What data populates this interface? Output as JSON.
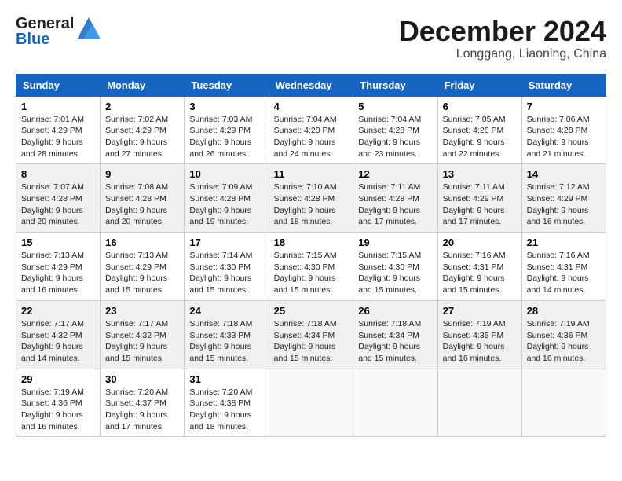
{
  "header": {
    "logo": {
      "general": "General",
      "blue": "Blue"
    },
    "title": "December 2024",
    "location": "Longgang, Liaoning, China"
  },
  "calendar": {
    "headers": [
      "Sunday",
      "Monday",
      "Tuesday",
      "Wednesday",
      "Thursday",
      "Friday",
      "Saturday"
    ],
    "rows": [
      [
        {
          "day": "1",
          "sunrise": "Sunrise: 7:01 AM",
          "sunset": "Sunset: 4:29 PM",
          "daylight": "Daylight: 9 hours and 28 minutes."
        },
        {
          "day": "2",
          "sunrise": "Sunrise: 7:02 AM",
          "sunset": "Sunset: 4:29 PM",
          "daylight": "Daylight: 9 hours and 27 minutes."
        },
        {
          "day": "3",
          "sunrise": "Sunrise: 7:03 AM",
          "sunset": "Sunset: 4:29 PM",
          "daylight": "Daylight: 9 hours and 26 minutes."
        },
        {
          "day": "4",
          "sunrise": "Sunrise: 7:04 AM",
          "sunset": "Sunset: 4:28 PM",
          "daylight": "Daylight: 9 hours and 24 minutes."
        },
        {
          "day": "5",
          "sunrise": "Sunrise: 7:04 AM",
          "sunset": "Sunset: 4:28 PM",
          "daylight": "Daylight: 9 hours and 23 minutes."
        },
        {
          "day": "6",
          "sunrise": "Sunrise: 7:05 AM",
          "sunset": "Sunset: 4:28 PM",
          "daylight": "Daylight: 9 hours and 22 minutes."
        },
        {
          "day": "7",
          "sunrise": "Sunrise: 7:06 AM",
          "sunset": "Sunset: 4:28 PM",
          "daylight": "Daylight: 9 hours and 21 minutes."
        }
      ],
      [
        {
          "day": "8",
          "sunrise": "Sunrise: 7:07 AM",
          "sunset": "Sunset: 4:28 PM",
          "daylight": "Daylight: 9 hours and 20 minutes."
        },
        {
          "day": "9",
          "sunrise": "Sunrise: 7:08 AM",
          "sunset": "Sunset: 4:28 PM",
          "daylight": "Daylight: 9 hours and 20 minutes."
        },
        {
          "day": "10",
          "sunrise": "Sunrise: 7:09 AM",
          "sunset": "Sunset: 4:28 PM",
          "daylight": "Daylight: 9 hours and 19 minutes."
        },
        {
          "day": "11",
          "sunrise": "Sunrise: 7:10 AM",
          "sunset": "Sunset: 4:28 PM",
          "daylight": "Daylight: 9 hours and 18 minutes."
        },
        {
          "day": "12",
          "sunrise": "Sunrise: 7:11 AM",
          "sunset": "Sunset: 4:28 PM",
          "daylight": "Daylight: 9 hours and 17 minutes."
        },
        {
          "day": "13",
          "sunrise": "Sunrise: 7:11 AM",
          "sunset": "Sunset: 4:29 PM",
          "daylight": "Daylight: 9 hours and 17 minutes."
        },
        {
          "day": "14",
          "sunrise": "Sunrise: 7:12 AM",
          "sunset": "Sunset: 4:29 PM",
          "daylight": "Daylight: 9 hours and 16 minutes."
        }
      ],
      [
        {
          "day": "15",
          "sunrise": "Sunrise: 7:13 AM",
          "sunset": "Sunset: 4:29 PM",
          "daylight": "Daylight: 9 hours and 16 minutes."
        },
        {
          "day": "16",
          "sunrise": "Sunrise: 7:13 AM",
          "sunset": "Sunset: 4:29 PM",
          "daylight": "Daylight: 9 hours and 15 minutes."
        },
        {
          "day": "17",
          "sunrise": "Sunrise: 7:14 AM",
          "sunset": "Sunset: 4:30 PM",
          "daylight": "Daylight: 9 hours and 15 minutes."
        },
        {
          "day": "18",
          "sunrise": "Sunrise: 7:15 AM",
          "sunset": "Sunset: 4:30 PM",
          "daylight": "Daylight: 9 hours and 15 minutes."
        },
        {
          "day": "19",
          "sunrise": "Sunrise: 7:15 AM",
          "sunset": "Sunset: 4:30 PM",
          "daylight": "Daylight: 9 hours and 15 minutes."
        },
        {
          "day": "20",
          "sunrise": "Sunrise: 7:16 AM",
          "sunset": "Sunset: 4:31 PM",
          "daylight": "Daylight: 9 hours and 15 minutes."
        },
        {
          "day": "21",
          "sunrise": "Sunrise: 7:16 AM",
          "sunset": "Sunset: 4:31 PM",
          "daylight": "Daylight: 9 hours and 14 minutes."
        }
      ],
      [
        {
          "day": "22",
          "sunrise": "Sunrise: 7:17 AM",
          "sunset": "Sunset: 4:32 PM",
          "daylight": "Daylight: 9 hours and 14 minutes."
        },
        {
          "day": "23",
          "sunrise": "Sunrise: 7:17 AM",
          "sunset": "Sunset: 4:32 PM",
          "daylight": "Daylight: 9 hours and 15 minutes."
        },
        {
          "day": "24",
          "sunrise": "Sunrise: 7:18 AM",
          "sunset": "Sunset: 4:33 PM",
          "daylight": "Daylight: 9 hours and 15 minutes."
        },
        {
          "day": "25",
          "sunrise": "Sunrise: 7:18 AM",
          "sunset": "Sunset: 4:34 PM",
          "daylight": "Daylight: 9 hours and 15 minutes."
        },
        {
          "day": "26",
          "sunrise": "Sunrise: 7:18 AM",
          "sunset": "Sunset: 4:34 PM",
          "daylight": "Daylight: 9 hours and 15 minutes."
        },
        {
          "day": "27",
          "sunrise": "Sunrise: 7:19 AM",
          "sunset": "Sunset: 4:35 PM",
          "daylight": "Daylight: 9 hours and 16 minutes."
        },
        {
          "day": "28",
          "sunrise": "Sunrise: 7:19 AM",
          "sunset": "Sunset: 4:36 PM",
          "daylight": "Daylight: 9 hours and 16 minutes."
        }
      ],
      [
        {
          "day": "29",
          "sunrise": "Sunrise: 7:19 AM",
          "sunset": "Sunset: 4:36 PM",
          "daylight": "Daylight: 9 hours and 16 minutes."
        },
        {
          "day": "30",
          "sunrise": "Sunrise: 7:20 AM",
          "sunset": "Sunset: 4:37 PM",
          "daylight": "Daylight: 9 hours and 17 minutes."
        },
        {
          "day": "31",
          "sunrise": "Sunrise: 7:20 AM",
          "sunset": "Sunset: 4:38 PM",
          "daylight": "Daylight: 9 hours and 18 minutes."
        },
        null,
        null,
        null,
        null
      ]
    ]
  }
}
